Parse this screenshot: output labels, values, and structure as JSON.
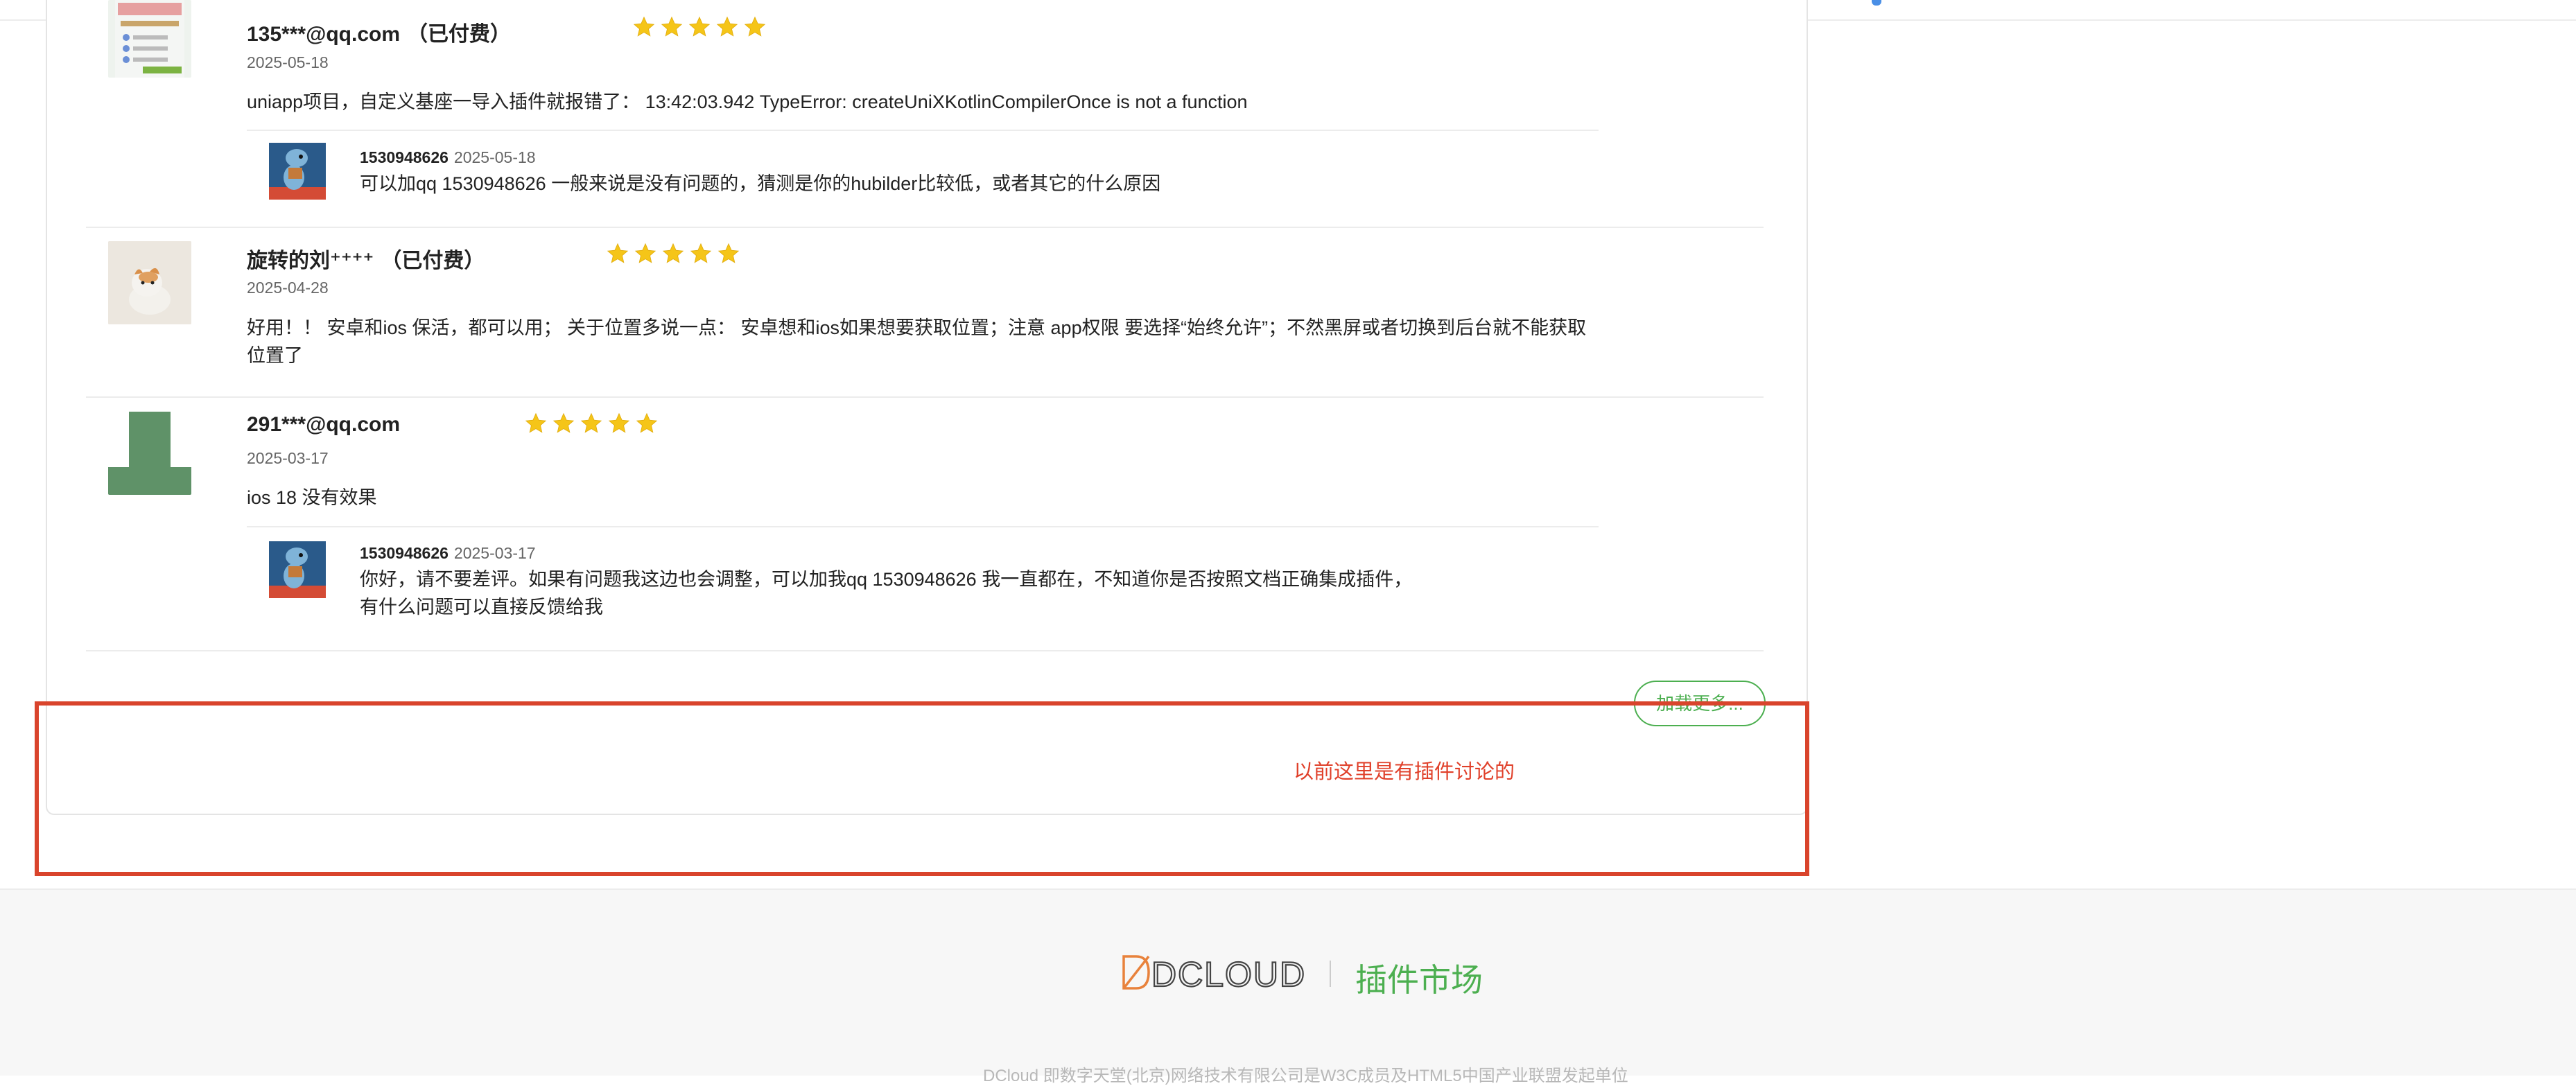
{
  "reviews": [
    {
      "username": "135***@qq.com",
      "paid_label": "（已付费）",
      "rating": 5,
      "date": "2025-05-18",
      "content": "uniapp项目，自定义基座一导入插件就报错了： 13:42:03.942 TypeError: createUniXKotlinCompilerOnce is not a function",
      "reply": {
        "author": "1530948626",
        "date": "2025-05-18",
        "text": "可以加qq 1530948626 一般来说是没有问题的，猜测是你的hubilder比较低，或者其它的什么原因"
      }
    },
    {
      "username": "旋转的刘⁺⁺⁺⁺",
      "paid_label": "（已付费）",
      "rating": 5,
      "date": "2025-04-28",
      "content": "好用！！ 安卓和ios 保活，都可以用； 关于位置多说一点： 安卓想和ios如果想要获取位置；注意 app权限 要选择“始终允许”；不然黑屏或者切换到后台就不能获取位置了"
    },
    {
      "username": "291***@qq.com",
      "paid_label": "",
      "rating": 5,
      "date": "2025-03-17",
      "content": "ios 18 没有效果",
      "reply": {
        "author": "1530948626",
        "date": "2025-03-17",
        "text": "你好，请不要差评。如果有问题我这边也会调整，可以加我qq 1530948626 我一直都在，不知道你是否按照文档正确集成插件，有什么问题可以直接反馈给我"
      }
    }
  ],
  "load_more_label": "加载更多...",
  "annotation_text": "以前这里是有插件讨论的",
  "annotation_color": "#d9442c",
  "footer": {
    "logo_text": "DCLOUD",
    "market_label": "插件市场",
    "copyright": "DCloud 即数字天堂(北京)网络技术有限公司是W3C成员及HTML5中国产业联盟发起单位"
  },
  "colors": {
    "accent_green": "#4caf50",
    "star": "#f5c518",
    "logo_orange": "#e8823c"
  }
}
